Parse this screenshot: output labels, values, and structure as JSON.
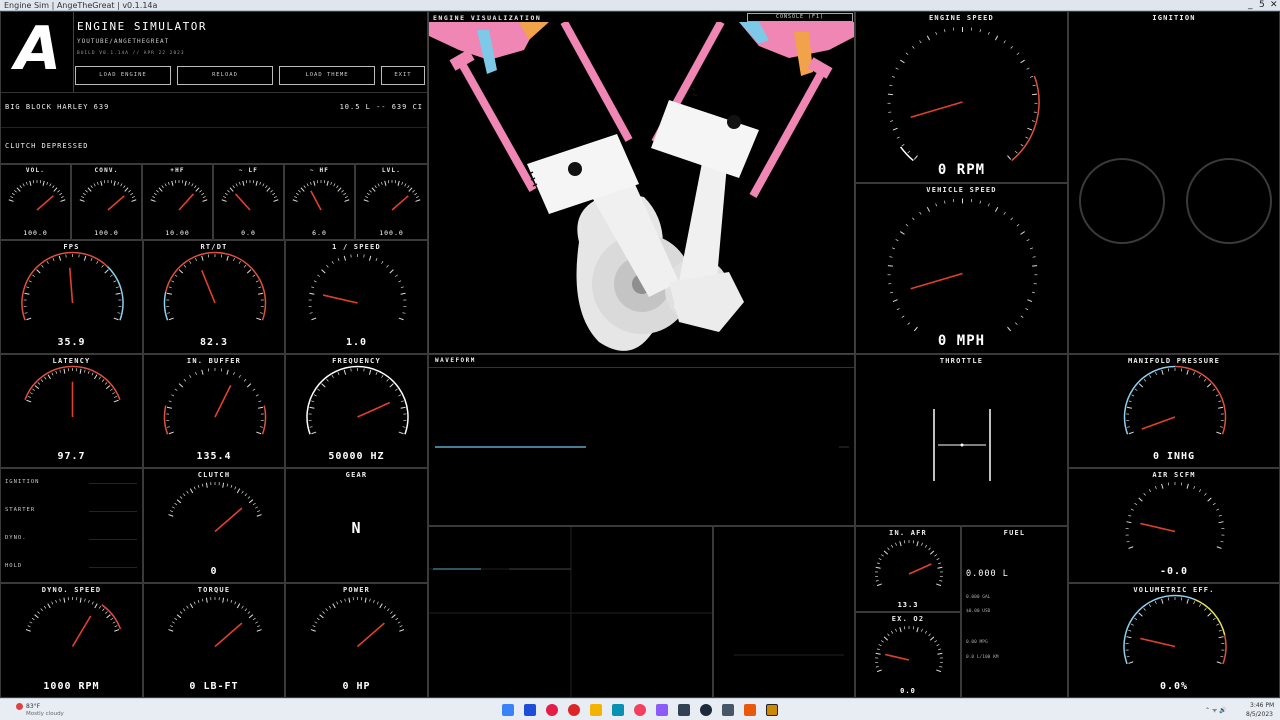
{
  "window": {
    "title": "Engine Sim | AngeTheGreat | v0.1.14a",
    "min": "_",
    "max": "5",
    "close": "✕"
  },
  "header": {
    "logo": "A",
    "title": "ENGINE SIMULATOR",
    "subtitle": "YOUTUBE/ANGETHEGREAT",
    "build": "BUILD V0.1.14A // APR 22 2023"
  },
  "buttons": {
    "load_engine": "LOAD ENGINE",
    "reload": "RELOAD",
    "load_theme": "LOAD THEME",
    "exit": "EXIT"
  },
  "engine": {
    "name": "BIG BLOCK HARLEY 639",
    "displacement": "10.5 L -- 639 CI",
    "status": "CLUTCH DEPRESSED"
  },
  "small_gauges": [
    {
      "label": "VOL.",
      "value": "100.0",
      "frac": 0.85
    },
    {
      "label": "CONV.",
      "value": "100.0",
      "frac": 0.85
    },
    {
      "label": "+HF",
      "value": "10.00",
      "frac": 0.8
    },
    {
      "label": "~ LF",
      "value": "0.0",
      "frac": 0.2
    },
    {
      "label": "~ HF",
      "value": "6.0",
      "frac": 0.3
    },
    {
      "label": "LVL.",
      "value": "100.0",
      "frac": 0.85
    }
  ],
  "gauges": {
    "fps": {
      "label": "FPS",
      "value": "35.9",
      "frac": 0.48
    },
    "rtdt": {
      "label": "RT/DT",
      "value": "82.3",
      "frac": 0.4
    },
    "inv_speed": {
      "label": "1 / SPEED",
      "value": "1.0",
      "frac": 0.15
    },
    "latency": {
      "label": "LATENCY",
      "value": "97.7",
      "frac": 0.5
    },
    "in_buffer": {
      "label": "IN. BUFFER",
      "value": "135.4",
      "frac": 0.62
    },
    "frequency": {
      "label": "FREQUENCY",
      "value": "50000 HZ",
      "frac": 0.8
    },
    "clutch": {
      "label": "CLUTCH",
      "value": "0",
      "frac": 0.85
    },
    "gear": {
      "label": "GEAR",
      "value": "N"
    },
    "dyno_speed": {
      "label": "DYNO. SPEED",
      "value": "1000 RPM",
      "frac": 0.72
    },
    "torque": {
      "label": "TORQUE",
      "value": "0 LB-FT",
      "frac": 0.85
    },
    "power": {
      "label": "POWER",
      "value": "0 HP",
      "frac": 0.85
    },
    "engine_speed": {
      "label": "ENGINE SPEED",
      "value": "0 RPM",
      "frac": 0.12
    },
    "vehicle_speed": {
      "label": "VEHICLE SPEED",
      "value": "0 MPH",
      "frac": 0.12
    },
    "manifold": {
      "label": "MANIFOLD PRESSURE",
      "value": "0 INHG",
      "frac": 0.0
    },
    "air_scfm": {
      "label": "AIR SCFM",
      "value": "-0.0",
      "frac": 0.15
    },
    "vol_eff": {
      "label": "VOLUMETRIC EFF.",
      "value": "0.0%",
      "frac": 0.15
    },
    "in_afr": {
      "label": "IN. AFR",
      "value": "13.3",
      "frac": 0.8
    },
    "ex_o2": {
      "label": "EX. O2",
      "value": "0.0",
      "frac": 0.15
    }
  },
  "indicators": [
    "IGNITION",
    "STARTER",
    "DYNO.",
    "HOLD"
  ],
  "panels": {
    "engine_vis": "ENGINE VISUALIZATION",
    "console": "CONSOLE (F1)",
    "waveform": "WAVEFORM",
    "ignition": "IGNITION",
    "throttle": "THROTTLE",
    "fuel": "FUEL"
  },
  "fuel": {
    "value": "0.000 L",
    "line1": "0.000 GAL",
    "line2": "$0.00 USD",
    "line3": "0.00 MPG",
    "line4": "0.0 L/100 KM"
  },
  "taskbar": {
    "weather_temp": "83°F",
    "weather_desc": "Mostly cloudy",
    "time": "3:46 PM",
    "date": "8/5/2023"
  },
  "colors": {
    "accent": "#e05040",
    "pink": "#ef86b4",
    "orange": "#f2a24a",
    "blue": "#7ec8e8",
    "bg": "#000000"
  }
}
